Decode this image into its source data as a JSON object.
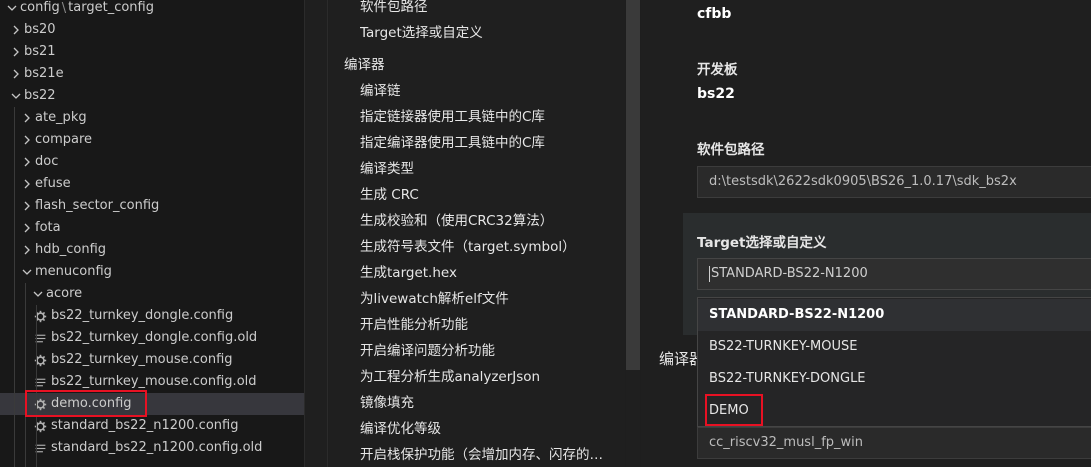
{
  "explorer": {
    "breadcrumb": [
      "config",
      "target_config"
    ],
    "rows": [
      {
        "label": "bs20",
        "kind": "folder",
        "expanded": false,
        "depth": 0
      },
      {
        "label": "bs21",
        "kind": "folder",
        "expanded": false,
        "depth": 0
      },
      {
        "label": "bs21e",
        "kind": "folder",
        "expanded": false,
        "depth": 0
      },
      {
        "label": "bs22",
        "kind": "folder",
        "expanded": true,
        "depth": 0
      },
      {
        "label": "ate_pkg",
        "kind": "folder",
        "expanded": false,
        "depth": 1
      },
      {
        "label": "compare",
        "kind": "folder",
        "expanded": false,
        "depth": 1
      },
      {
        "label": "doc",
        "kind": "folder",
        "expanded": false,
        "depth": 1
      },
      {
        "label": "efuse",
        "kind": "folder",
        "expanded": false,
        "depth": 1
      },
      {
        "label": "flash_sector_config",
        "kind": "folder",
        "expanded": false,
        "depth": 1
      },
      {
        "label": "fota",
        "kind": "folder",
        "expanded": false,
        "depth": 1
      },
      {
        "label": "hdb_config",
        "kind": "folder",
        "expanded": false,
        "depth": 1
      },
      {
        "label": "menuconfig",
        "kind": "folder",
        "expanded": true,
        "depth": 1
      },
      {
        "label": "acore",
        "kind": "folder",
        "expanded": true,
        "depth": 2
      },
      {
        "label": "bs22_turnkey_dongle.config",
        "kind": "gear",
        "depth": 3
      },
      {
        "label": "bs22_turnkey_dongle.config.old",
        "kind": "lines",
        "depth": 3
      },
      {
        "label": "bs22_turnkey_mouse.config",
        "kind": "gear",
        "depth": 3
      },
      {
        "label": "bs22_turnkey_mouse.config.old",
        "kind": "lines",
        "depth": 3
      },
      {
        "label": "demo.config",
        "kind": "gear",
        "depth": 3,
        "selected": true
      },
      {
        "label": "standard_bs22_n1200.config",
        "kind": "gear",
        "depth": 3
      },
      {
        "label": "standard_bs22_n1200.config.old",
        "kind": "lines",
        "depth": 3
      }
    ]
  },
  "nav": {
    "top_items": [
      "软件包路径",
      "Target选择或自定义"
    ],
    "group_label": "编译器",
    "compiler_items": [
      "编译链",
      "指定链接器使用工具链中的C库",
      "指定编译器使用工具链中的C库",
      "编译类型",
      "生成 CRC",
      "生成校验和（使用CRC32算法）",
      "生成符号表文件（target.symbol）",
      "生成target.hex",
      "为livewatch解析elf文件",
      "开启性能分析功能",
      "开启编译问题分析功能",
      "为工程分析生成analyzerJson",
      "镜像填充",
      "编译优化等级",
      "开启栈保护功能（会增加内存、闪存的…"
    ]
  },
  "settings": {
    "top_value": "cfbb",
    "board_title": "开发板",
    "board_value": "bs22",
    "pkg_path_title": "软件包路径",
    "pkg_path_value": "d:\\testsdk\\2622sdk0905\\BS26_1.0.17\\sdk_bs2x",
    "target_title": "Target选择或自定义",
    "target_value": "STANDARD-BS22-N1200",
    "target_options": [
      "STANDARD-BS22-N1200",
      "BS22-TURNKEY-MOUSE",
      "BS22-TURNKEY-DONGLE",
      "DEMO"
    ],
    "compiler_peek": "编译器",
    "toolchain_value": "cc_riscv32_musl_fp_win"
  },
  "colors": {
    "background": "#1e1e1e",
    "highlight_box": "#e81123",
    "selected_row": "#37373d"
  }
}
